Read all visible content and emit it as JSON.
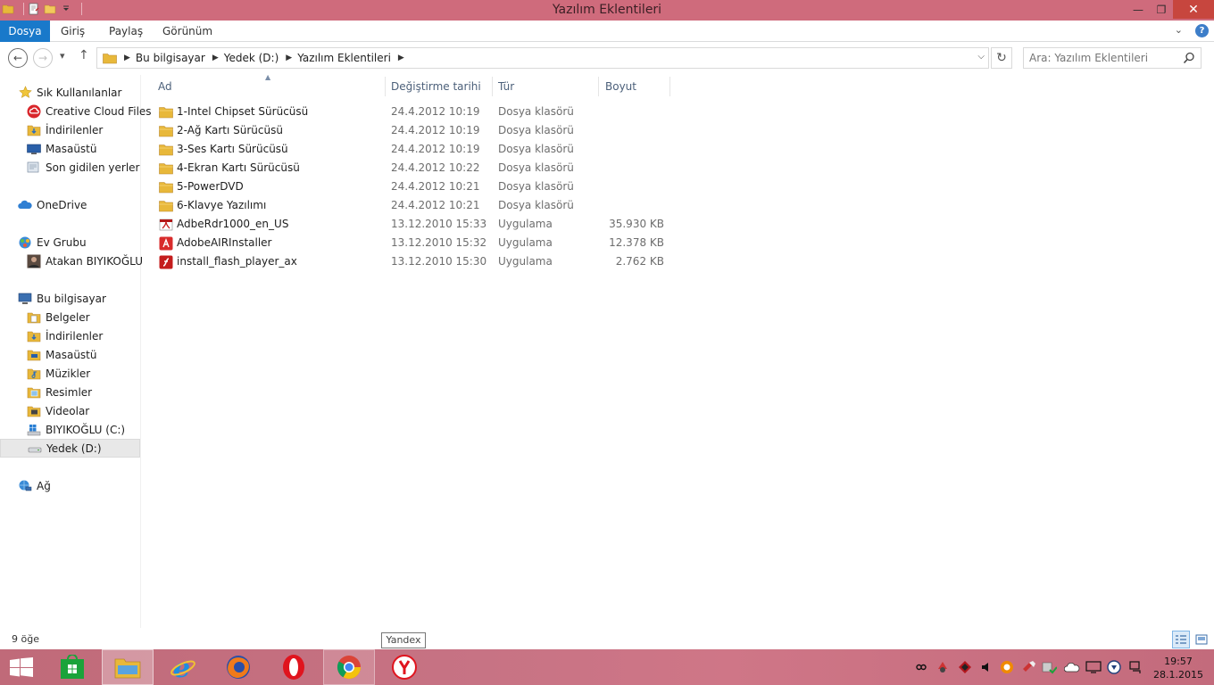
{
  "window": {
    "title": "Yazılım Eklentileri",
    "min_glyph": "—",
    "max_glyph": "❐",
    "close_glyph": "✕"
  },
  "ribbon": {
    "tabs": [
      "Dosya",
      "Giriş",
      "Paylaş",
      "Görünüm"
    ],
    "expand_glyph": "⌄",
    "help_glyph": "?"
  },
  "address": {
    "crumbs": [
      "Bu bilgisayar",
      "Yedek (D:)",
      "Yazılım Eklentileri"
    ],
    "sep_glyph": "▶",
    "dropdown_glyph": "⌵",
    "refresh_glyph": "↻"
  },
  "nav": {
    "back_glyph": "←",
    "forward_glyph": "→",
    "recent_glyph": "▾",
    "up_glyph": "↑"
  },
  "search": {
    "placeholder": "Ara: Yazılım Eklentileri"
  },
  "sidebar": {
    "favorites": {
      "label": "Sık Kullanılanlar",
      "items": [
        "Creative Cloud Files",
        "İndirilenler",
        "Masaüstü",
        "Son gidilen yerler"
      ]
    },
    "onedrive": "OneDrive",
    "homegroup": {
      "label": "Ev Grubu",
      "items": [
        "Atakan BIYIKOĞLU"
      ]
    },
    "thispc": {
      "label": "Bu bilgisayar",
      "items": [
        "Belgeler",
        "İndirilenler",
        "Masaüstü",
        "Müzikler",
        "Resimler",
        "Videolar",
        "BIYIKOĞLU (C:)",
        "Yedek (D:)"
      ]
    },
    "network": "Ağ"
  },
  "columns": {
    "name": "Ad",
    "date": "Değiştirme tarihi",
    "type": "Tür",
    "size": "Boyut"
  },
  "files": [
    {
      "name": "1-Intel Chipset Sürücüsü",
      "date": "24.4.2012 10:19",
      "type": "Dosya klasörü",
      "size": "",
      "icon": "folder-icon"
    },
    {
      "name": "2-Ağ Kartı Sürücüsü",
      "date": "24.4.2012 10:19",
      "type": "Dosya klasörü",
      "size": "",
      "icon": "folder-icon"
    },
    {
      "name": "3-Ses Kartı Sürücüsü",
      "date": "24.4.2012 10:19",
      "type": "Dosya klasörü",
      "size": "",
      "icon": "folder-icon"
    },
    {
      "name": "4-Ekran Kartı Sürücüsü",
      "date": "24.4.2012 10:22",
      "type": "Dosya klasörü",
      "size": "",
      "icon": "folder-icon"
    },
    {
      "name": "5-PowerDVD",
      "date": "24.4.2012 10:21",
      "type": "Dosya klasörü",
      "size": "",
      "icon": "folder-icon"
    },
    {
      "name": "6-Klavye Yazılımı",
      "date": "24.4.2012 10:21",
      "type": "Dosya klasörü",
      "size": "",
      "icon": "folder-icon"
    },
    {
      "name": "AdbeRdr1000_en_US",
      "date": "13.12.2010 15:33",
      "type": "Uygulama",
      "size": "35.930 KB",
      "icon": "adobe-reader-icon"
    },
    {
      "name": "AdobeAIRInstaller",
      "date": "13.12.2010 15:32",
      "type": "Uygulama",
      "size": "12.378 KB",
      "icon": "adobe-air-icon"
    },
    {
      "name": "install_flash_player_ax",
      "date": "13.12.2010 15:30",
      "type": "Uygulama",
      "size": "2.762 KB",
      "icon": "flash-player-icon"
    }
  ],
  "status": {
    "item_count": "9 öğe"
  },
  "tooltip": "Yandex",
  "clock": {
    "time": "19:57",
    "date": "28.1.2015"
  },
  "colors": {
    "titlebar": "#cf6b7c",
    "file_tab": "#1979ca",
    "close": "#c7463e",
    "folder": "#e8b83a"
  }
}
